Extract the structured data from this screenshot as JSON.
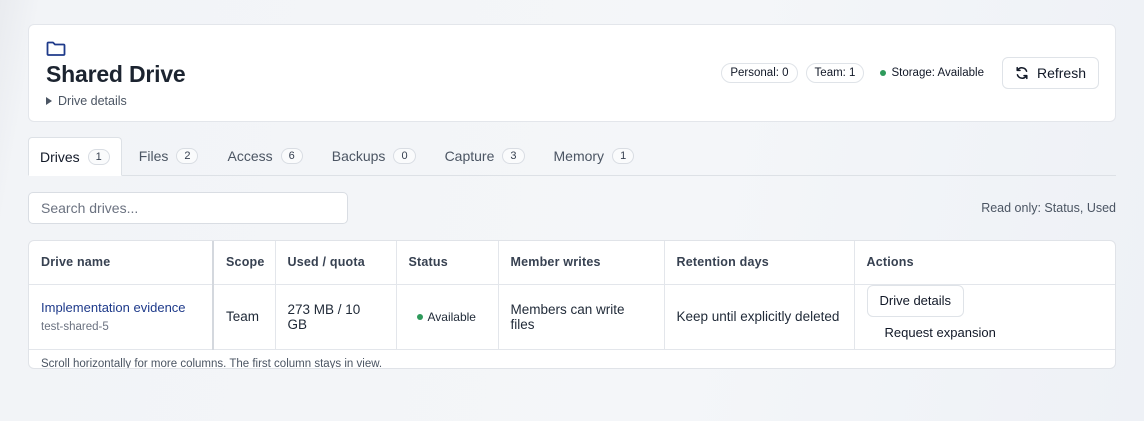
{
  "header": {
    "title": "Shared Drive",
    "details_toggle": "Drive details",
    "personal_pill": "Personal: 0",
    "team_pill": "Team: 1",
    "storage_status": "Storage: Available",
    "refresh_label": "Refresh",
    "status_color": "#2e9a5b"
  },
  "tabs": [
    {
      "label": "Drives",
      "count": "1"
    },
    {
      "label": "Files",
      "count": "2"
    },
    {
      "label": "Access",
      "count": "6"
    },
    {
      "label": "Backups",
      "count": "0"
    },
    {
      "label": "Capture",
      "count": "3"
    },
    {
      "label": "Memory",
      "count": "1"
    }
  ],
  "search": {
    "placeholder": "Search drives..."
  },
  "readonly_note": "Read only: Status, Used",
  "table": {
    "columns": [
      "Drive name",
      "Scope",
      "Used / quota",
      "Status",
      "Member writes",
      "Retention days",
      "Actions"
    ],
    "rows": [
      {
        "name": "Implementation evidence",
        "id": "test-shared-5",
        "scope": "Team",
        "used": "273 MB / 10 GB",
        "status": "Available",
        "member_writes": "Members can write files",
        "retention": "Keep until explicitly deleted",
        "action_primary": "Drive details",
        "action_secondary": "Request expansion"
      }
    ],
    "footer_note": "Scroll horizontally for more columns. The first column stays in view."
  },
  "icons": {
    "folder": "folder-icon",
    "refresh": "refresh-icon",
    "disclosure": "disclosure-triangle-icon",
    "accent": "#1e3a8a"
  }
}
